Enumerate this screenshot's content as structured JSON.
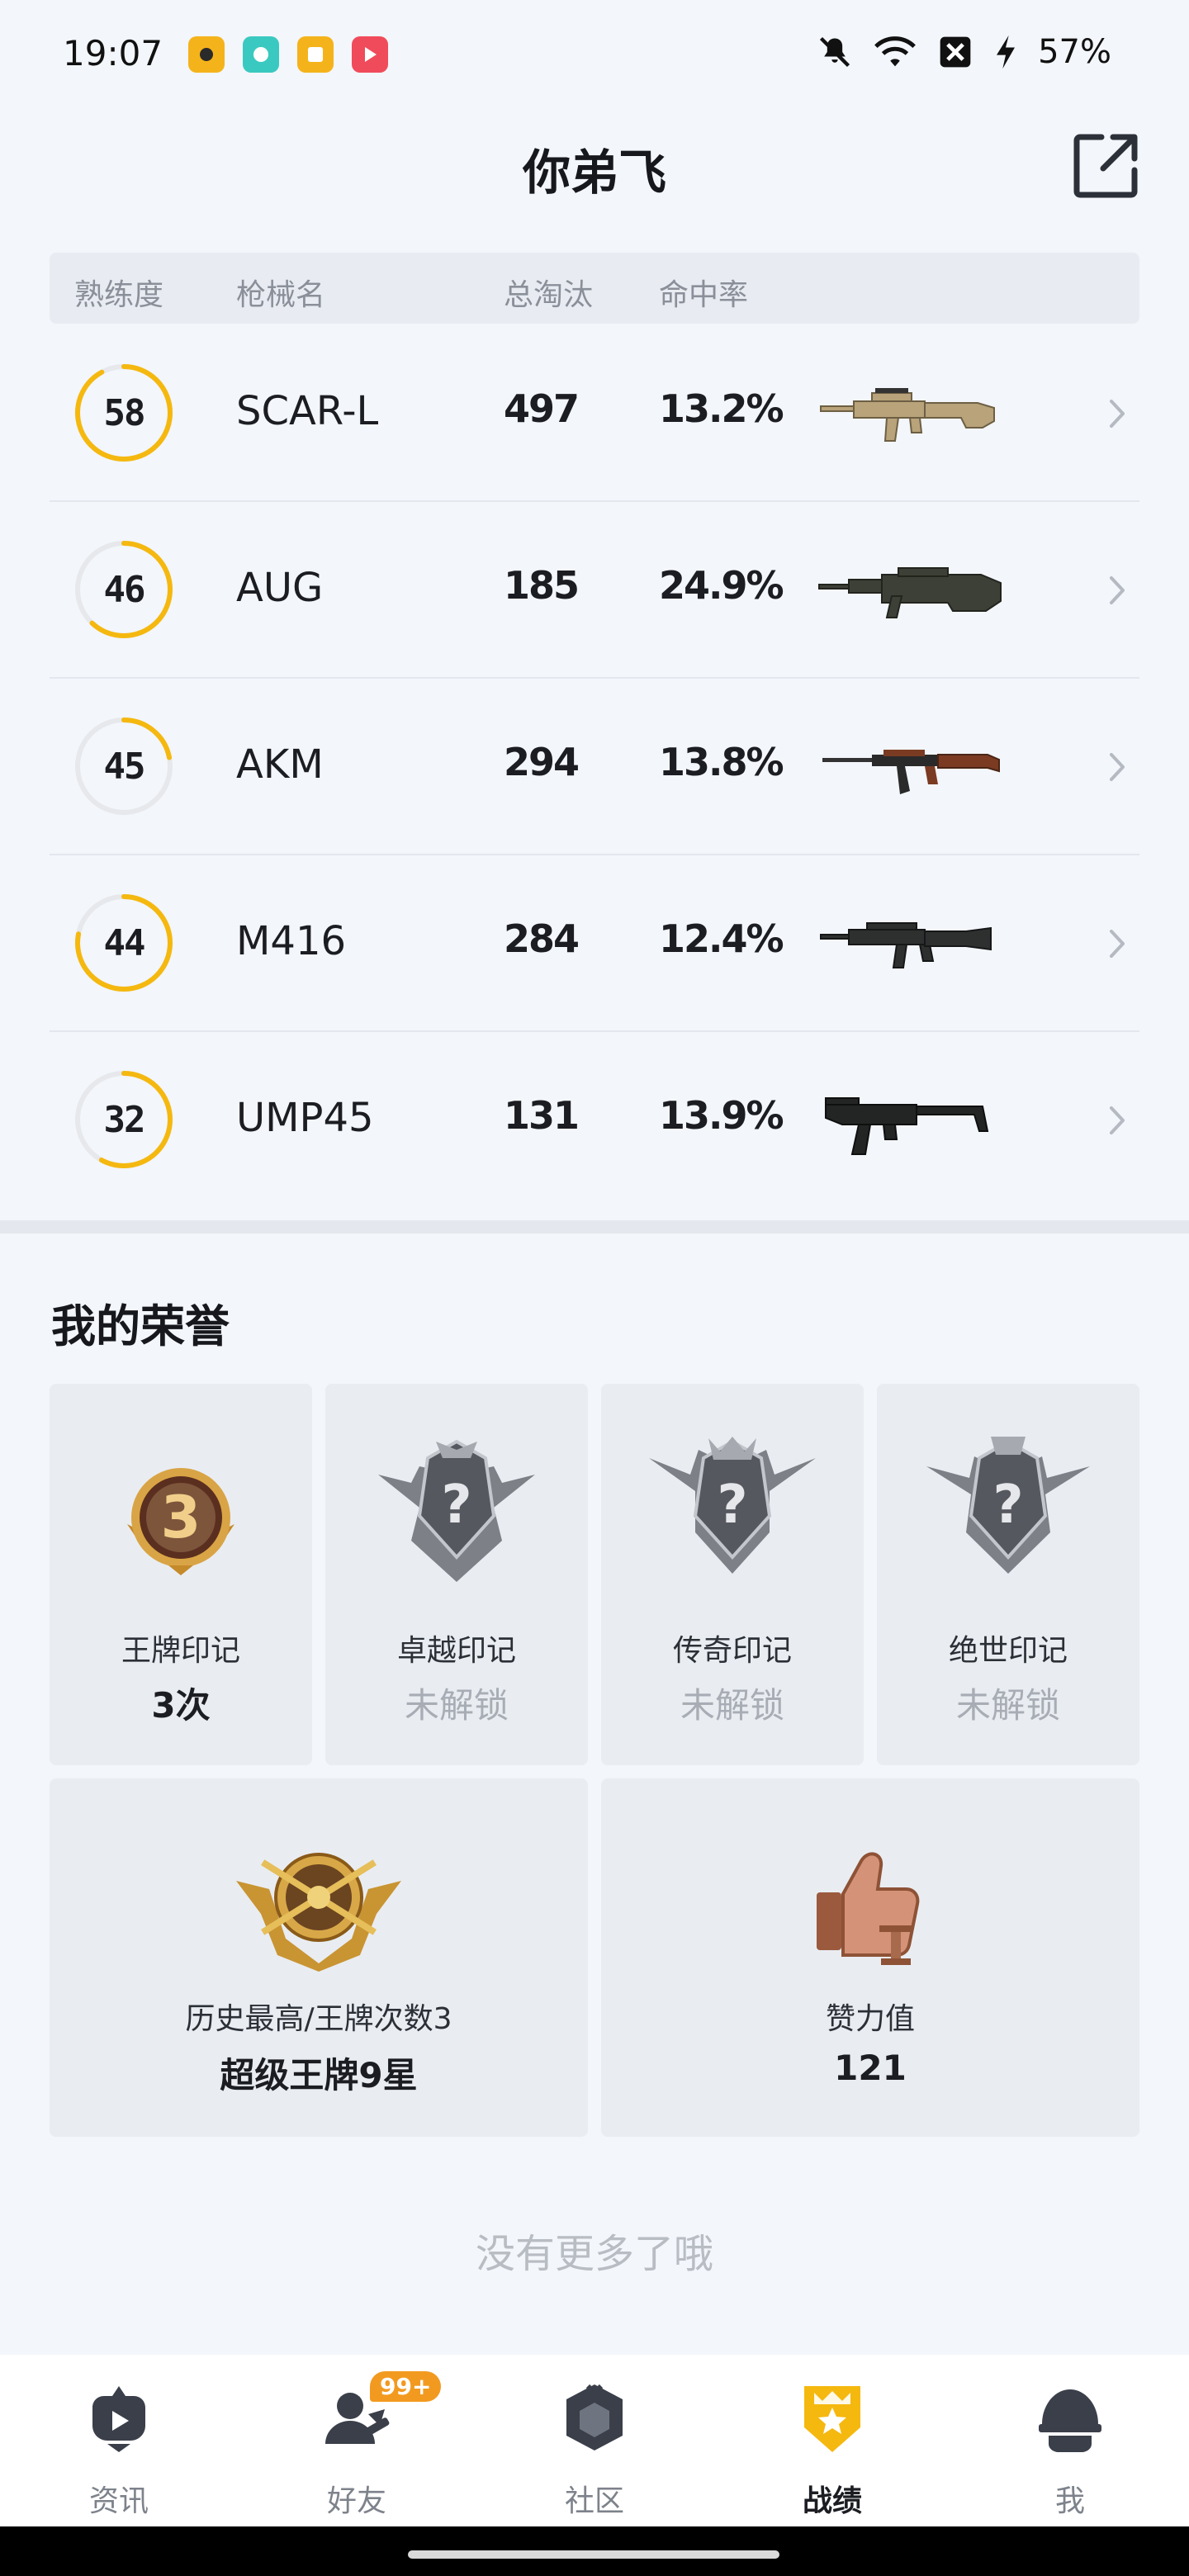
{
  "status_bar": {
    "time": "19:07",
    "notification_icons": [
      {
        "name": "app-icon-1",
        "color": "#f5b31b"
      },
      {
        "name": "app-icon-2",
        "color": "#3ac9c0"
      },
      {
        "name": "app-icon-3",
        "color": "#f5b31b"
      },
      {
        "name": "app-icon-4",
        "color": "#f04b5a"
      }
    ],
    "battery": "57%"
  },
  "header": {
    "title": "你弟飞",
    "share_icon": "share-icon"
  },
  "table": {
    "headers": [
      "熟练度",
      "枪械名",
      "总淘汰",
      "命中率"
    ],
    "rows": [
      {
        "mastery": "58",
        "progress": 0.92,
        "gun": "SCAR-L",
        "kills": "497",
        "hit_rate": "13.2%"
      },
      {
        "mastery": "46",
        "progress": 0.62,
        "gun": "AUG",
        "kills": "185",
        "hit_rate": "24.9%"
      },
      {
        "mastery": "45",
        "progress": 0.22,
        "gun": "AKM",
        "kills": "294",
        "hit_rate": "13.8%"
      },
      {
        "mastery": "44",
        "progress": 0.78,
        "gun": "M416",
        "kills": "284",
        "hit_rate": "12.4%"
      },
      {
        "mastery": "32",
        "progress": 0.58,
        "gun": "UMP45",
        "kills": "131",
        "hit_rate": "13.9%"
      }
    ]
  },
  "honors": {
    "title": "我的荣誉",
    "badges": [
      {
        "label": "王牌印记",
        "value": "3次",
        "locked": false,
        "icon": "ace-emblem-icon"
      },
      {
        "label": "卓越印记",
        "value": "未解锁",
        "locked": true,
        "icon": "locked-emblem-icon"
      },
      {
        "label": "传奇印记",
        "value": "未解锁",
        "locked": true,
        "icon": "locked-emblem-icon"
      },
      {
        "label": "绝世印记",
        "value": "未解锁",
        "locked": true,
        "icon": "locked-emblem-icon"
      }
    ],
    "wide": [
      {
        "label": "历史最高/王牌次数3",
        "value": "超级王牌9星",
        "icon": "rank-emblem-icon"
      },
      {
        "label": "赞力值",
        "value": "121",
        "icon": "thumbs-up-icon"
      }
    ]
  },
  "footer_text": "没有更多了哦",
  "nav": {
    "items": [
      {
        "label": "资讯",
        "icon": "news-icon"
      },
      {
        "label": "好友",
        "icon": "friends-icon",
        "badge": "99+"
      },
      {
        "label": "社区",
        "icon": "community-icon"
      },
      {
        "label": "战绩",
        "icon": "record-icon",
        "active": true
      },
      {
        "label": "我",
        "icon": "profile-helmet-icon"
      }
    ]
  },
  "colors": {
    "accent": "#f5b80f",
    "ring_track": "#e6e8ec",
    "badge": "#f29a1f"
  }
}
